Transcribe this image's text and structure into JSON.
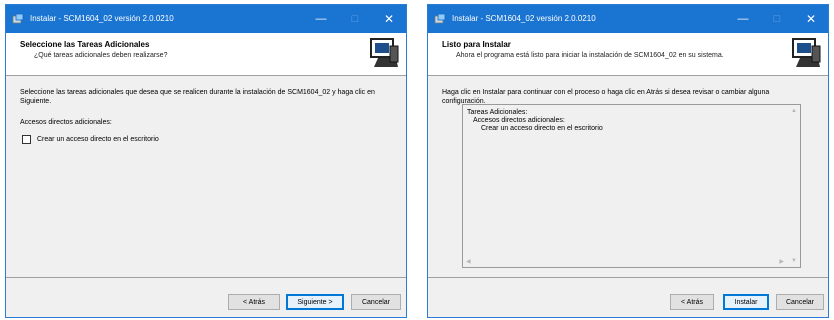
{
  "window1": {
    "title": "Instalar - SCM1604_02 versión 2.0.0210",
    "header_title": "Seleccione las Tareas Adicionales",
    "header_subtitle": "¿Qué tareas adicionales deben realizarse?",
    "paragraph": "Seleccione las tareas adicionales que desea que se realicen durante la instalación de SCM1604_02 y haga clic en Siguiente.",
    "group_label": "Accesos directos adicionales:",
    "checkbox_label": "Crear un acceso directo en el escritorio",
    "checkbox_checked": false,
    "back_label": "< Atrás",
    "next_label": "Siguiente >",
    "cancel_label": "Cancelar"
  },
  "window2": {
    "title": "Instalar - SCM1604_02 versión 2.0.0210",
    "header_title": "Listo para Instalar",
    "header_subtitle": "Ahora el programa está listo para iniciar la instalación de SCM1604_02 en su sistema.",
    "paragraph": "Haga clic en Instalar para continuar con el proceso o haga clic en Atrás si desea revisar o cambiar alguna configuración.",
    "memo": {
      "line1": "Tareas Adicionales:",
      "line2": "Accesos directos adicionales:",
      "line3": "Crear un acceso directo en el escritorio"
    },
    "back_label": "< Atrás",
    "install_label": "Instalar",
    "cancel_label": "Cancelar"
  },
  "titlebar": {
    "minimize": "—",
    "maximize": "□",
    "close": "✕"
  },
  "colors": {
    "titlebar": "#1a74d2",
    "default_button_border": "#0078d7"
  }
}
